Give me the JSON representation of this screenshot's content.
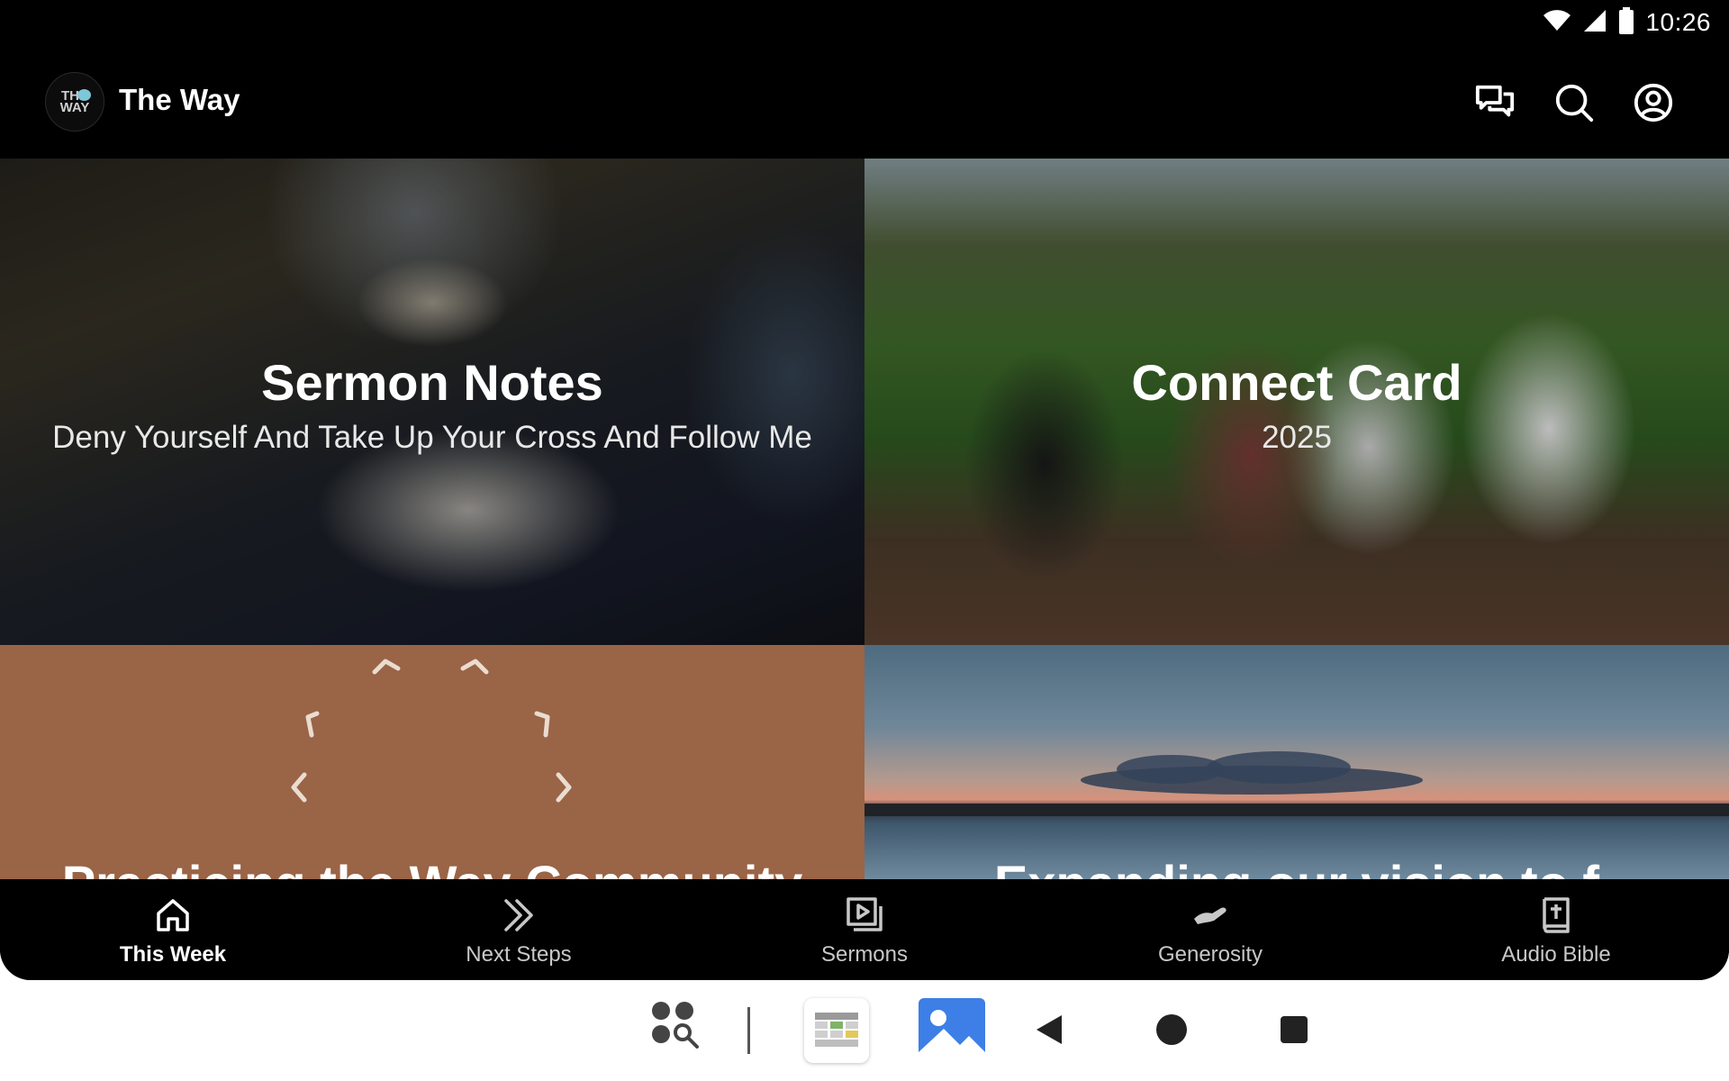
{
  "status_bar": {
    "time": "10:26",
    "icons": [
      "wifi-icon",
      "cell-signal-icon",
      "battery-icon"
    ]
  },
  "app_bar": {
    "logo_text": "THE WAY",
    "title": "The Way",
    "actions": [
      "chat-icon",
      "search-icon",
      "account-icon"
    ]
  },
  "tiles": [
    {
      "title": "Sermon Notes",
      "subtitle": "Deny Yourself And Take Up Your Cross And Follow Me"
    },
    {
      "title": "Connect Card",
      "subtitle": "2025"
    },
    {
      "title": "Practicing the Way Community"
    },
    {
      "title": "Expanding our vision to f"
    }
  ],
  "bottom_nav": [
    {
      "label": "This Week",
      "icon": "home-icon",
      "active": true
    },
    {
      "label": "Next Steps",
      "icon": "double-chevron-right-icon",
      "active": false
    },
    {
      "label": "Sermons",
      "icon": "video-library-icon",
      "active": false
    },
    {
      "label": "Generosity",
      "icon": "hand-icon",
      "active": false
    },
    {
      "label": "Audio Bible",
      "icon": "bible-icon",
      "active": false
    }
  ],
  "system_bar": {
    "items": [
      "app-search-icon",
      "divider",
      "calendar-app-icon",
      "gallery-app-icon",
      "back-icon",
      "home-circle-icon",
      "recents-icon"
    ]
  },
  "colors": {
    "background": "#000000",
    "text_primary": "#ffffff",
    "text_secondary": "#c8c8c8",
    "tile_brown": "#9a6446"
  }
}
